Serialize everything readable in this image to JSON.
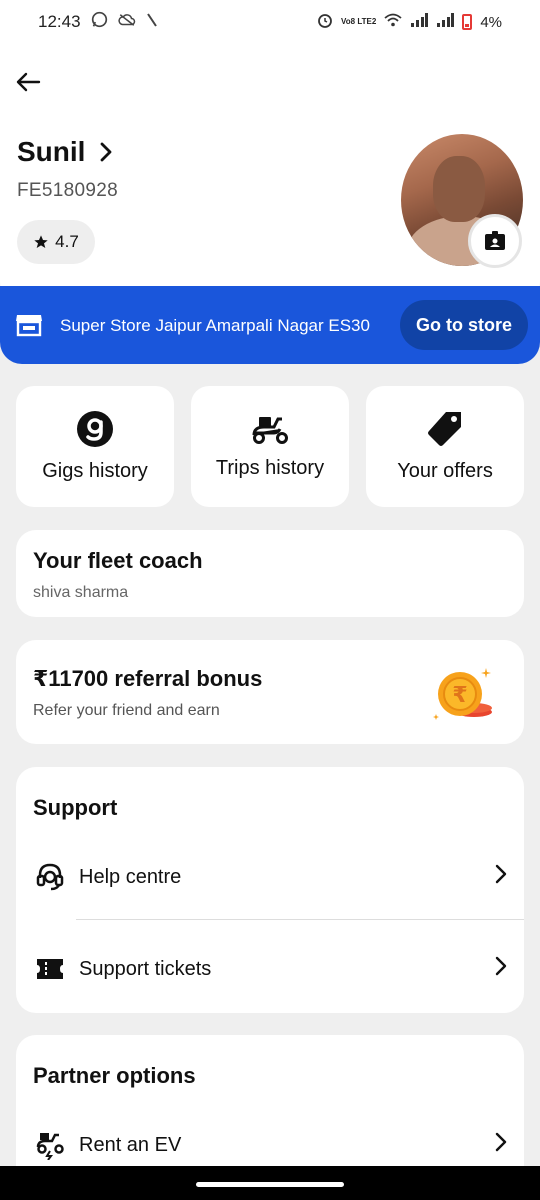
{
  "status_bar": {
    "time": "12:43",
    "network_label": "Vo8 LTE2",
    "battery": "4%"
  },
  "profile": {
    "name": "Sunil",
    "id": "FE5180928",
    "rating": "4.7"
  },
  "store": {
    "name": "Super Store Jaipur Amarpali Nagar ES30",
    "button_label": "Go to store",
    "brand_color": "#1a56db"
  },
  "tiles": [
    {
      "label": "Gigs history",
      "icon": "gigs-g-icon"
    },
    {
      "label": "Trips history",
      "icon": "scooter-icon"
    },
    {
      "label": "Your offers",
      "icon": "tag-icon"
    }
  ],
  "fleet_coach": {
    "title": "Your fleet coach",
    "name": "shiva sharma"
  },
  "referral": {
    "title": "₹11700 referral bonus",
    "subtitle": "Refer your friend and earn",
    "coin_symbol": "₹"
  },
  "support": {
    "title": "Support",
    "items": [
      {
        "label": "Help centre",
        "icon": "headset-icon"
      },
      {
        "label": "Support tickets",
        "icon": "ticket-icon"
      }
    ]
  },
  "partner_options": {
    "title": "Partner options",
    "items": [
      {
        "label": "Rent an EV",
        "icon": "ev-scooter-icon"
      }
    ]
  }
}
